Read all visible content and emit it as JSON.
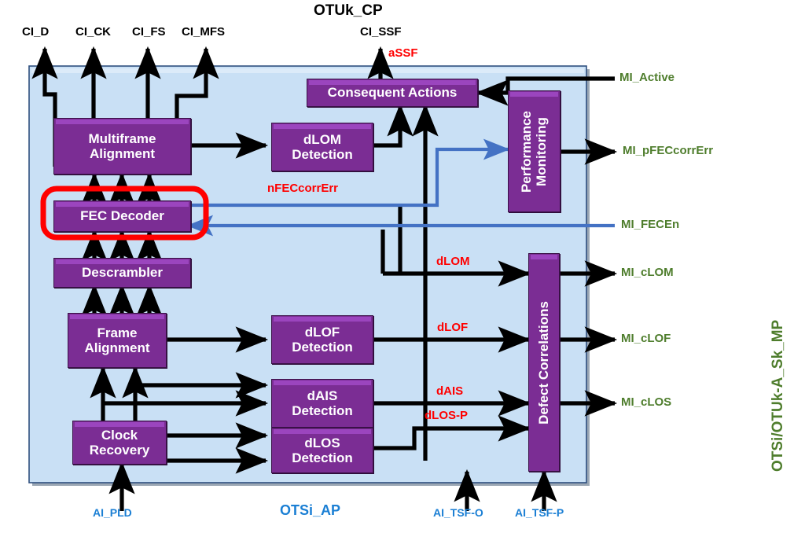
{
  "diagram": {
    "title_top": "OTUk_CP",
    "title_bottom": "OTSi_AP",
    "title_right": "OTSi/OTUk-A_Sk_MP",
    "colors": {
      "box_fill": "#7B2D94",
      "box_bevel": "#9B45BE",
      "container_fill": "#C9E0F5",
      "highlight": "#FF0000",
      "signal_black": "#000000",
      "signal_blue": "#4472C4",
      "defect_red": "#FF0000",
      "mi_green": "#4E7D2C",
      "ap_blue": "#1B7FD4"
    }
  },
  "blocks": {
    "multiframe_alignment": "Multiframe\nAlignment",
    "multiframe_alignment_l1": "Multiframe",
    "multiframe_alignment_l2": "Alignment",
    "fec_decoder": "FEC Decoder",
    "descrambler": "Descrambler",
    "frame_alignment_l1": "Frame",
    "frame_alignment_l2": "Alignment",
    "clock_recovery_l1": "Clock",
    "clock_recovery_l2": "Recovery",
    "dlom_detection_l1": "dLOM",
    "dlom_detection_l2": "Detection",
    "dlof_detection_l1": "dLOF",
    "dlof_detection_l2": "Detection",
    "dais_detection_l1": "dAIS",
    "dais_detection_l2": "Detection",
    "dlos_detection_l1": "dLOS",
    "dlos_detection_l2": "Detection",
    "consequent_actions": "Consequent Actions",
    "performance_monitoring_l1": "Performance",
    "performance_monitoring_l2": "Monitoring",
    "defect_correlations": "Defect Correlations"
  },
  "ci_signals": [
    {
      "name": "CI_D",
      "label": "CI_D"
    },
    {
      "name": "CI_CK",
      "label": "CI_CK"
    },
    {
      "name": "CI_FS",
      "label": "CI_FS"
    },
    {
      "name": "CI_MFS",
      "label": "CI_MFS"
    },
    {
      "name": "CI_SSF",
      "label": "CI_SSF"
    }
  ],
  "internal_signals": [
    {
      "name": "aSSF",
      "label": "aSSF"
    },
    {
      "name": "nFECcorrErr",
      "label": "nFECcorrErr"
    },
    {
      "name": "dLOM",
      "label": "dLOM"
    },
    {
      "name": "dLOF",
      "label": "dLOF"
    },
    {
      "name": "dAIS",
      "label": "dAIS"
    },
    {
      "name": "dLOS-P",
      "label": "dLOS-P"
    }
  ],
  "mi_signals": [
    {
      "name": "MI_Active",
      "label": "MI_Active"
    },
    {
      "name": "MI_pFECcorrErr",
      "label": "MI_pFECcorrErr"
    },
    {
      "name": "MI_FECEn",
      "label": "MI_FECEn"
    },
    {
      "name": "MI_cLOM",
      "label": "MI_cLOM"
    },
    {
      "name": "MI_cLOF",
      "label": "MI_cLOF"
    },
    {
      "name": "MI_cLOS",
      "label": "MI_cLOS"
    }
  ],
  "ai_signals": [
    {
      "name": "AI_PLD",
      "label": "AI_PLD"
    },
    {
      "name": "AI_TSF-O",
      "label": "AI_TSF-O"
    },
    {
      "name": "AI_TSF-P",
      "label": "AI_TSF-P"
    }
  ],
  "highlight": {
    "target": "FEC Decoder",
    "shape": "rounded-rectangle",
    "color": "#FF0000"
  }
}
